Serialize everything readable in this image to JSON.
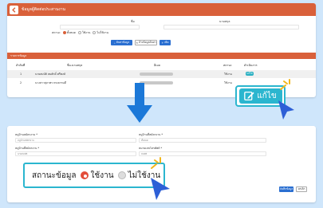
{
  "top_panel": {
    "title": "ข้อมูลผู้ติดต่อประสานงาน",
    "filter": {
      "name_label": "ชื่อ",
      "nickname_label": "นามสกุล",
      "status_label": "สถานะ",
      "status_options": [
        "ทั้งหมด",
        "ใช้งาน",
        "ไม่ใช้งาน"
      ]
    },
    "buttons": {
      "search": "ค้นหาข้อมูล",
      "clear": "ล้างข้อมูลค้นหา",
      "add": "เพิ่ม"
    },
    "section_title": "รายการข้อมูล",
    "table": {
      "headers": [
        "ลำดับที่",
        "ชื่อ-นามสกุล",
        "อีเมล",
        "สถานะ",
        "ดำเนินการ"
      ],
      "rows": [
        {
          "no": "1",
          "name": "นายสมบัติ สมศักดิ์ ศรีพงษ์",
          "status": "ใช้งาน",
          "action": "แก้ไข"
        },
        {
          "no": "2",
          "name": "นางสาวสุภาพร ทรงธรรมดี",
          "status": "ใช้งาน",
          "action": "แก้ไข"
        }
      ]
    }
  },
  "edit_callout": {
    "label": "แก้ไข"
  },
  "form_panel": {
    "fields": [
      {
        "label": "หมู่บ้านสมัครงาน *",
        "value": "หมู่บ้านสมัครงาน"
      },
      {
        "label": "หมู่บ้านที่สมัครงาน *",
        "value": "ทั้งหมด"
      },
      {
        "label": "หมู่บ้านที่สมัครงาน *",
        "value": "นายสมบัติ"
      },
      {
        "label": "หมายเลขโทรศัพท์ *",
        "value": "สมบัติ"
      }
    ],
    "buttons": {
      "save": "บันทึกข้อมูล",
      "cancel": "ยกเลิก"
    }
  },
  "status_callout": {
    "label": "สถานะข้อมูล",
    "options": [
      "ใช้งาน",
      "ไม่ใช้งาน"
    ],
    "selected": "ใช้งาน"
  },
  "colors": {
    "header": "#d9603a",
    "accent": "#2bb6cf",
    "arrow": "#1b78d8",
    "cursor": "#2d5fd6",
    "spark": "#f2b619"
  }
}
